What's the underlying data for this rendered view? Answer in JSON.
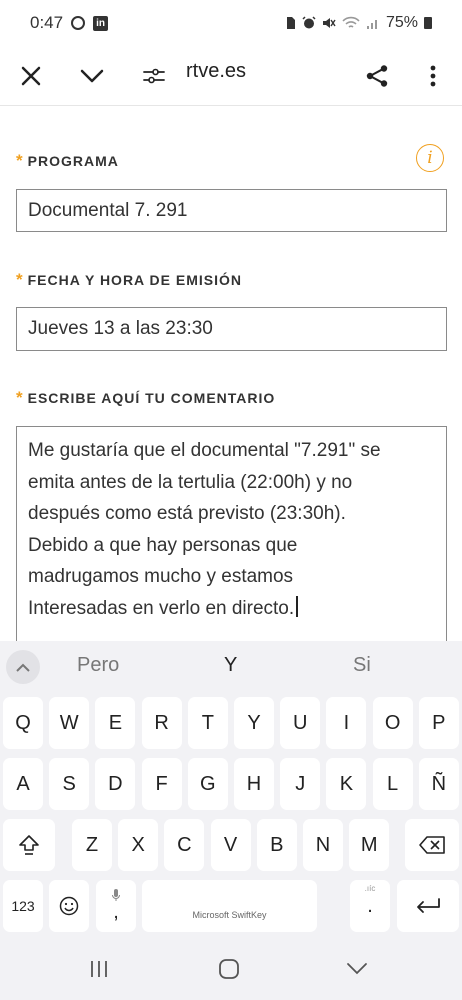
{
  "status_bar": {
    "time": "0:47",
    "battery_text": "75%",
    "left_icons": [
      "circle-icon",
      "linkedin-icon"
    ],
    "right_icons": [
      "sim-icon",
      "alarm-icon",
      "mute-icon",
      "wifi-icon",
      "signal-icon",
      "battery-icon"
    ]
  },
  "toolbar": {
    "url": "rtve.es",
    "icons": [
      "close-icon",
      "chevron-down-icon",
      "site-settings-icon",
      "share-icon",
      "more-vert-icon"
    ]
  },
  "form": {
    "info_glyph": "i",
    "required_mark": "*",
    "fields": [
      {
        "label": "PROGRAMA",
        "value": "Documental 7. 291"
      },
      {
        "label": "FECHA Y HORA DE EMISIÓN",
        "value": "Jueves 13 a las 23:30"
      },
      {
        "label": "ESCRIBE AQUÍ TU COMENTARIO",
        "lines": [
          "Me gustaría que el documental \"7.291\" se",
          "emita antes de la tertulia (22:00h) y no",
          "después como está previsto (23:30h).",
          "Debido a que hay personas que",
          "madrugamos mucho y estamos",
          "Interesadas en verlo en directo."
        ]
      }
    ]
  },
  "keyboard": {
    "suggestions": [
      "Pero",
      "Y",
      "Si"
    ],
    "row1": [
      "Q",
      "W",
      "E",
      "R",
      "T",
      "Y",
      "U",
      "I",
      "O",
      "P"
    ],
    "row2": [
      "A",
      "S",
      "D",
      "F",
      "G",
      "H",
      "J",
      "K",
      "L",
      "Ñ"
    ],
    "row3": [
      "Z",
      "X",
      "C",
      "V",
      "B",
      "N",
      "M"
    ],
    "numbers_key": "123",
    "comma_key": ",",
    "period_key": ".",
    "period_hint": ".ıíc",
    "space_label": "Microsoft SwiftKey"
  },
  "navbar": {
    "icons": [
      "recent-apps-icon",
      "home-icon",
      "back-icon"
    ]
  }
}
